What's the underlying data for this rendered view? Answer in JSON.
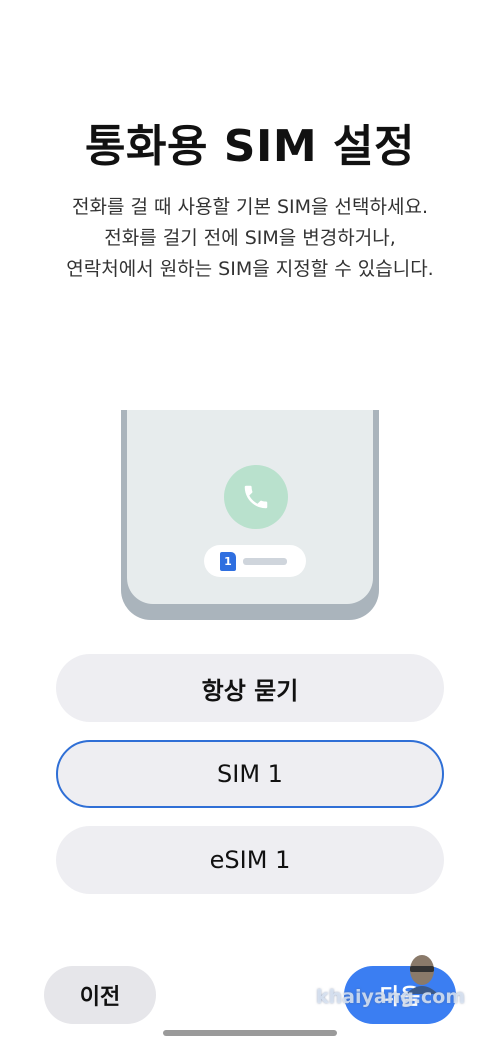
{
  "header": {
    "title": "통화용 SIM 설정",
    "description_lines": [
      "전화를 걸 때 사용할 기본 SIM을 선택하세요.",
      "전화를 걸기 전에 SIM을 변경하거나,",
      "연락처에서 원하는 SIM을 지정할 수 있습니다."
    ]
  },
  "illustration": {
    "sim_number": "1",
    "icon": "phone-icon",
    "colors": {
      "call_circle": "#b9e1cd",
      "phone_glyph": "#ffffff",
      "sim_badge": "#2f6fe0"
    }
  },
  "options": [
    {
      "label": "항상 묻기",
      "selected": false
    },
    {
      "label": "SIM 1",
      "selected": true
    },
    {
      "label": "eSIM 1",
      "selected": false
    }
  ],
  "footer": {
    "prev_label": "이전",
    "next_label": "다음"
  },
  "watermark": {
    "text": "khaiyang.com"
  },
  "colors": {
    "accent": "#3b7ef2",
    "selected_border": "#2f6fd6",
    "option_bg": "#eeeef2"
  }
}
